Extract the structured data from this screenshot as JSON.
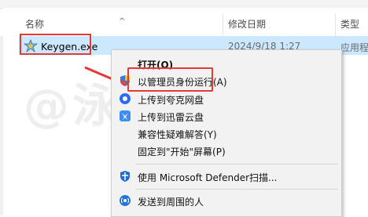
{
  "columns": {
    "name": "名称",
    "date": "修改日期",
    "type": "类型"
  },
  "file": {
    "name": "Keygen.exe",
    "date": "2024/9/18 1:27",
    "type": "应用程"
  },
  "watermark": "@泳云风",
  "menu": {
    "items": [
      {
        "label": "打开(O)",
        "icon": "none",
        "bold": true
      },
      {
        "label": "以管理员身份运行(A)",
        "icon": "shield-icon"
      },
      {
        "label": "上传到夸克网盘",
        "icon": "quark-icon"
      },
      {
        "label": "上传到迅雷云盘",
        "icon": "thunder-icon"
      },
      {
        "label": "兼容性疑难解答(Y)",
        "icon": "none"
      },
      {
        "label": "固定到\"开始\"屏幕(P)",
        "icon": "none"
      },
      {
        "label": "使用 Microsoft Defender扫描...",
        "icon": "defender-icon"
      },
      {
        "label": "发送到周围的人",
        "icon": "share-icon"
      }
    ]
  },
  "colors": {
    "highlight": "#e53935",
    "selection": "#cce8ff",
    "accent": "#0a63c9"
  }
}
